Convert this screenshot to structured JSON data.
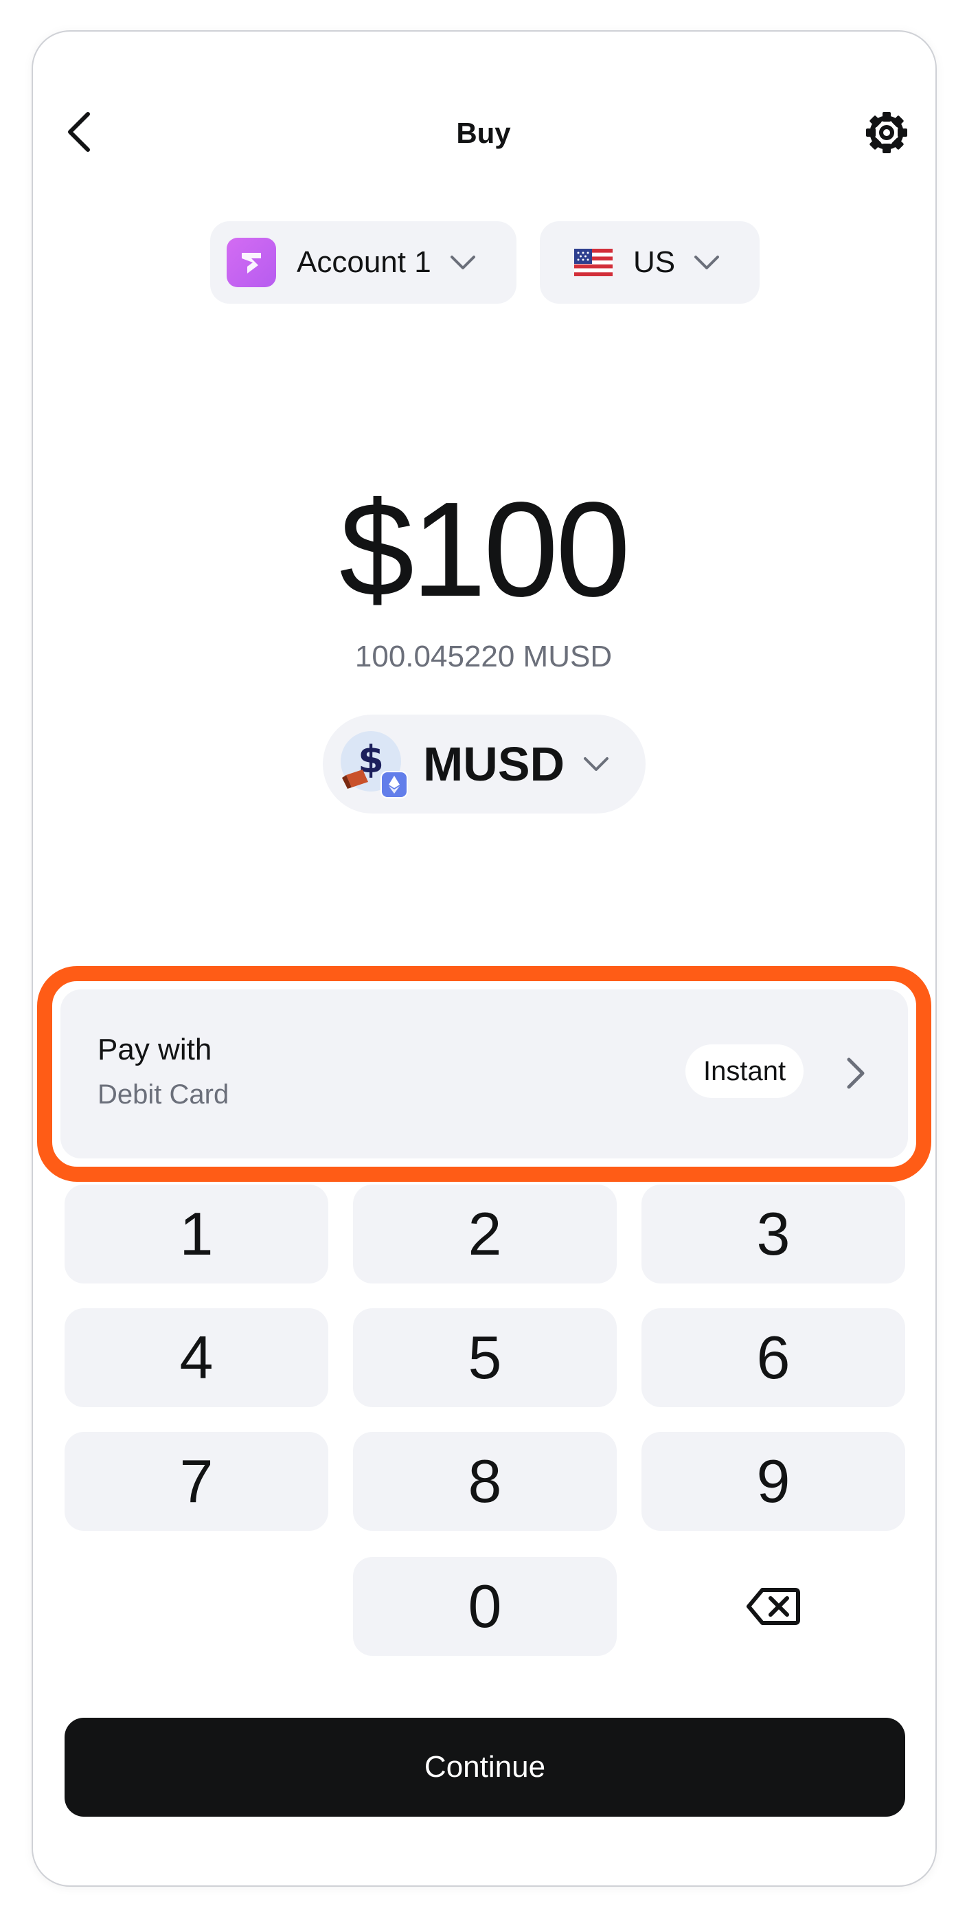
{
  "header": {
    "title": "Buy",
    "back_icon": "chevron-left-icon",
    "settings_icon": "gear-icon"
  },
  "account_selector": {
    "label": "Account 1",
    "icon": "account-avatar-icon",
    "accent": "#c764f1"
  },
  "region_selector": {
    "label": "US",
    "icon": "us-flag-icon"
  },
  "amount": {
    "fiat": "$100",
    "crypto": "100.045220 MUSD"
  },
  "token_selector": {
    "label": "MUSD",
    "icon": "musd-token-icon",
    "network_icon": "ethereum-icon"
  },
  "payment": {
    "title": "Pay with",
    "method": "Debit Card",
    "badge": "Instant",
    "highlight_color": "#ff5c16"
  },
  "keypad": {
    "keys": [
      "1",
      "2",
      "3",
      "4",
      "5",
      "6",
      "7",
      "8",
      "9",
      "0"
    ],
    "backspace_icon": "backspace-icon"
  },
  "footer": {
    "continue_label": "Continue"
  }
}
